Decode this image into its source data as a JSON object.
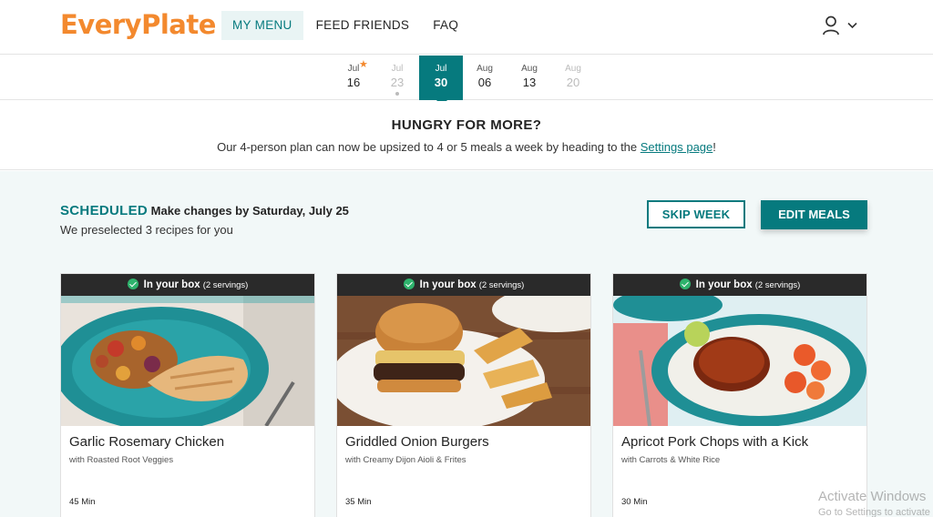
{
  "header": {
    "logo": "EveryPlate",
    "nav": [
      "MY MENU",
      "FEED FRIENDS",
      "FAQ"
    ],
    "active_nav": "MY MENU"
  },
  "weeks": [
    {
      "month": "Jul",
      "day": "16",
      "state": "starred"
    },
    {
      "month": "Jul",
      "day": "23",
      "state": "past"
    },
    {
      "month": "Jul",
      "day": "30",
      "state": "active"
    },
    {
      "month": "Aug",
      "day": "06",
      "state": "upcoming"
    },
    {
      "month": "Aug",
      "day": "13",
      "state": "upcoming"
    },
    {
      "month": "Aug",
      "day": "20",
      "state": "past"
    }
  ],
  "promo": {
    "title": "HUNGRY FOR MORE?",
    "text_before": "Our 4-person plan can now be upsized to 4 or 5 meals a week by heading to the ",
    "link": "Settings page",
    "text_after": "!"
  },
  "schedule": {
    "label": "SCHEDULED",
    "deadline": "Make changes by Saturday, July 25",
    "subtitle": "We preselected 3 recipes for you",
    "skip_label": "SKIP WEEK",
    "edit_label": "EDIT MEALS"
  },
  "cards": [
    {
      "band": "In your box",
      "servings": "(2 servings)",
      "title": "Garlic Rosemary Chicken",
      "subtitle": "with Roasted Root Veggies",
      "time": "45 Min"
    },
    {
      "band": "In your box",
      "servings": "(2 servings)",
      "title": "Griddled Onion Burgers",
      "subtitle": "with Creamy Dijon Aioli & Frites",
      "time": "35 Min"
    },
    {
      "band": "In your box",
      "servings": "(2 servings)",
      "title": "Apricot Pork Chops with a Kick",
      "subtitle": "with Carrots & White Rice",
      "time": "30 Min"
    }
  ],
  "watermark": {
    "line1": "Activate Windows",
    "line2": "Go to Settings to activate"
  },
  "colors": {
    "brand_orange": "#f3892e",
    "brand_teal": "#067a7e",
    "check_green": "#2fb36d"
  }
}
